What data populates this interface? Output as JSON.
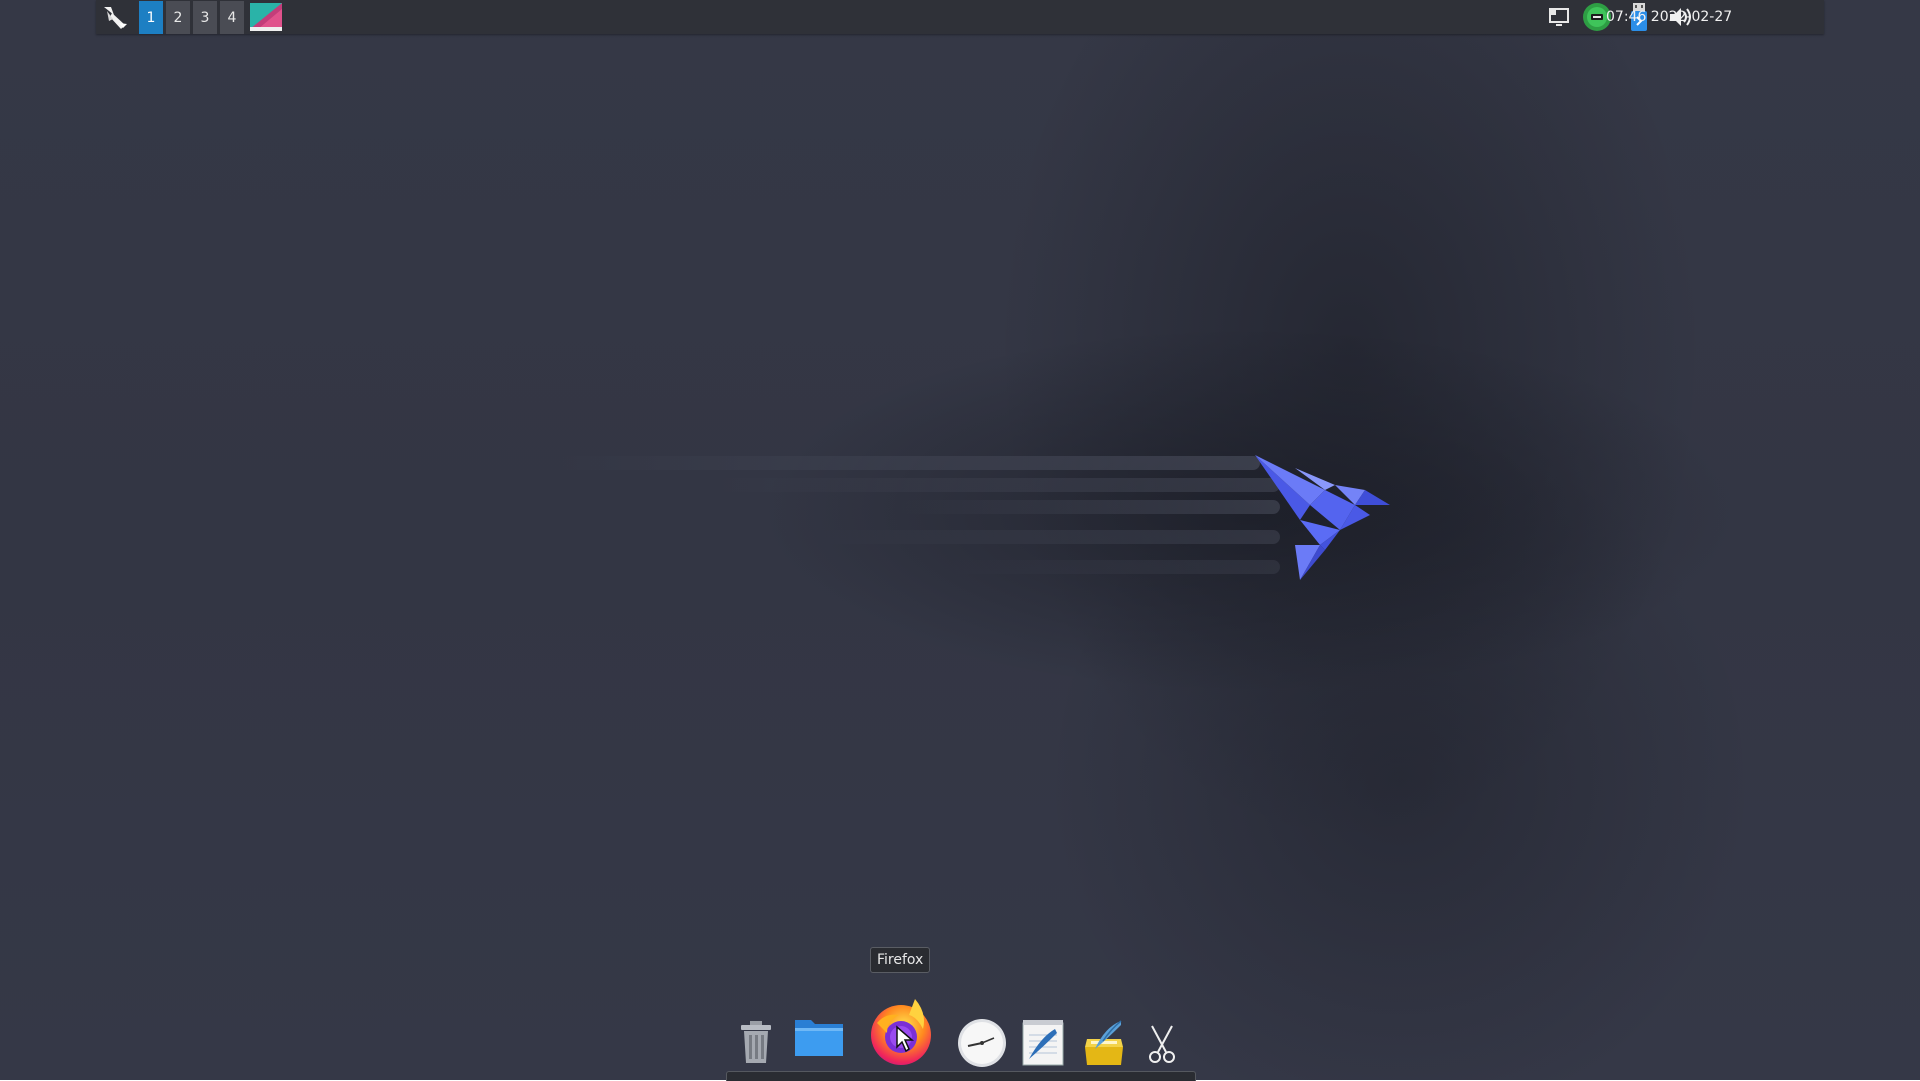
{
  "panel": {
    "menu_icon": "parrot-menu-icon",
    "workspaces": [
      "1",
      "2",
      "3",
      "4"
    ],
    "active_workspace": "1",
    "tray_icons": [
      "display-icon",
      "network-status-icon",
      "usb-drive-icon",
      "volume-icon"
    ],
    "clock": "07:46 2022-02-27"
  },
  "dock": {
    "items": [
      {
        "name": "Trash",
        "icon": "trash-icon"
      },
      {
        "name": "Files",
        "icon": "folder-icon"
      },
      {
        "name": "Firefox",
        "icon": "firefox-icon"
      },
      {
        "name": "Clock",
        "icon": "clock-icon"
      },
      {
        "name": "Text Editor",
        "icon": "text-editor-icon"
      },
      {
        "name": "Notes",
        "icon": "notes-icon"
      },
      {
        "name": "Screenshot",
        "icon": "scissors-icon"
      }
    ],
    "tooltip": "Firefox"
  },
  "colors": {
    "active_workspace": "#1d7fc3",
    "panel_bg": "#2f3138",
    "bird": "#5b6cf5"
  }
}
